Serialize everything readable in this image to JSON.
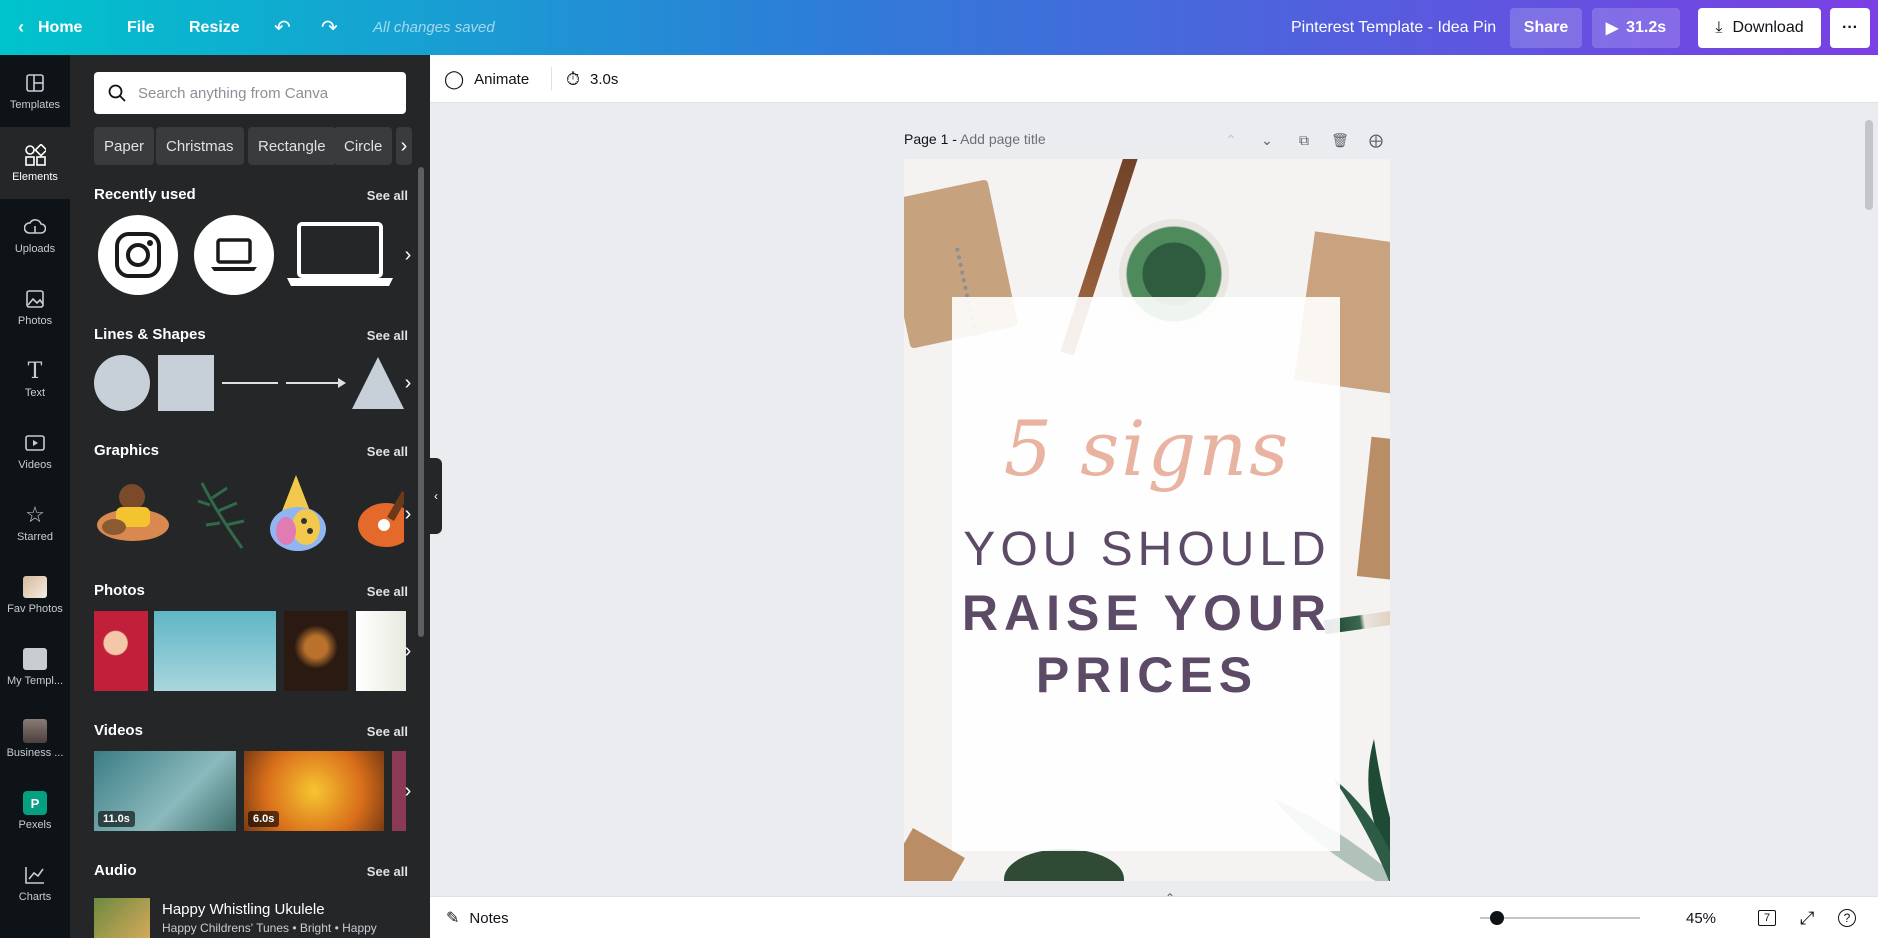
{
  "topbar": {
    "home": "Home",
    "file": "File",
    "resize": "Resize",
    "status": "All changes saved",
    "doc_title": "Pinterest Template - Idea Pin",
    "share": "Share",
    "play": "31.2s",
    "download": "Download",
    "more": "···"
  },
  "rail": [
    {
      "label": "Templates",
      "icon": "templates-icon"
    },
    {
      "label": "Elements",
      "icon": "elements-icon"
    },
    {
      "label": "Uploads",
      "icon": "uploads-icon"
    },
    {
      "label": "Photos",
      "icon": "photos-icon"
    },
    {
      "label": "Text",
      "icon": "text-icon"
    },
    {
      "label": "Videos",
      "icon": "videos-icon"
    },
    {
      "label": "Starred",
      "icon": "star-icon"
    },
    {
      "label": "Fav Photos",
      "icon": "folder-thumb-icon"
    },
    {
      "label": "My Templ...",
      "icon": "folder-thumb-icon"
    },
    {
      "label": "Business ...",
      "icon": "avatar-icon"
    },
    {
      "label": "Pexels",
      "icon": "pexels-icon"
    },
    {
      "label": "Charts",
      "icon": "charts-icon"
    }
  ],
  "panel": {
    "search_placeholder": "Search anything from Canva",
    "chips": [
      "Paper",
      "Christmas",
      "Rectangle",
      "Circle"
    ],
    "see_all": "See all",
    "sections": {
      "recent": "Recently used",
      "lines": "Lines & Shapes",
      "graphics": "Graphics",
      "photos": "Photos",
      "videos": "Videos",
      "audio": "Audio"
    },
    "videos": [
      "11.0s",
      "6.0s"
    ],
    "audio": {
      "title": "Happy Whistling Ukulele",
      "subtitle": "Happy Childrens' Tunes • Bright • Happy"
    }
  },
  "editor": {
    "animate": "Animate",
    "duration": "3.0s",
    "page_label": "Page 1 -",
    "page_title_placeholder": "Add page title"
  },
  "design": {
    "script": "5 signs",
    "line1": "YOU SHOULD",
    "line2": "RAISE YOUR",
    "line3": "PRICES"
  },
  "bottombar": {
    "notes": "Notes",
    "zoom": "45%",
    "pages": "7"
  }
}
